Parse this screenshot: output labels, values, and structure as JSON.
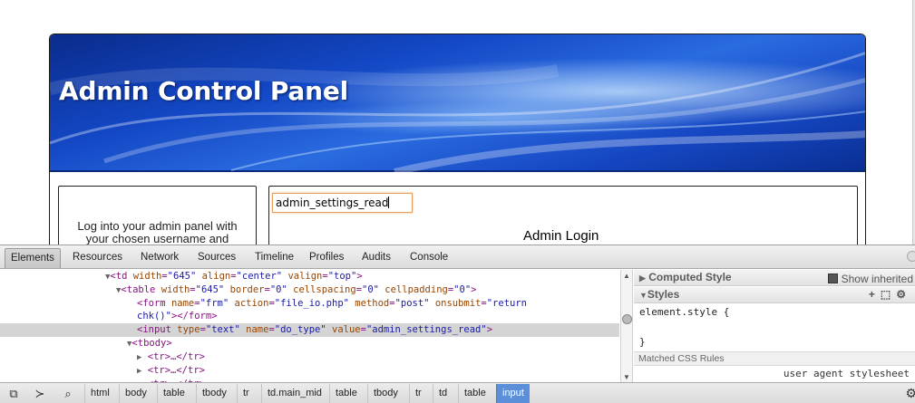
{
  "webpage": {
    "panel_title": "Admin Control Panel",
    "left_text_line1": "Log into your admin panel with",
    "left_text_line2": "your chosen username and",
    "input_value": "admin_settings_read",
    "login_heading": "Admin Login"
  },
  "devtools": {
    "tabs": [
      "Elements",
      "Resources",
      "Network",
      "Sources",
      "Timeline",
      "Profiles",
      "Audits",
      "Console"
    ],
    "selected_tab": "Elements",
    "dom": {
      "l1_tag": "td",
      "l1_a1": "width",
      "l1_v1": "\"645\"",
      "l1_a2": "align",
      "l1_v2": "\"center\"",
      "l1_a3": "valign",
      "l1_v3": "\"top\"",
      "l2_tag": "table",
      "l2_a1": "width",
      "l2_v1": "\"645\"",
      "l2_a2": "border",
      "l2_v2": "\"0\"",
      "l2_a3": "cellspacing",
      "l2_v3": "\"0\"",
      "l2_a4": "cellpadding",
      "l2_v4": "\"0\"",
      "l3_tag": "form",
      "l3_a1": "name",
      "l3_v1": "\"frm\"",
      "l3_a2": "action",
      "l3_v2": "\"file_io.php\"",
      "l3_a3": "method",
      "l3_v3": "\"post\"",
      "l3_a4": "onsubmit",
      "l3_v4a": "\"return",
      "l4_v4b": "chk()\"",
      "l4_close": "></form>",
      "l5_tag": "input",
      "l5_a1": "type",
      "l5_v1": "\"text\"",
      "l5_a2": "name",
      "l5_v2": "\"do_type\"",
      "l5_a3": "value",
      "l5_v3": "\"admin_settings_read\"",
      "l6_tag": "<tbody>",
      "tr_collapsed": "<tr>…</tr>"
    },
    "sidebar": {
      "computed_style": "Computed Style",
      "show_inherited": "Show inherited",
      "styles": "Styles",
      "element_style": "element.style {",
      "element_style_close": "}",
      "matched_rules": "Matched CSS Rules",
      "user_agent": "user agent stylesheet"
    },
    "breadcrumbs": [
      "html",
      "body",
      "table",
      "tbody",
      "tr",
      "td.main_mid",
      "table",
      "tbody",
      "tr",
      "td",
      "table",
      "input"
    ],
    "selected_crumb": "input"
  }
}
